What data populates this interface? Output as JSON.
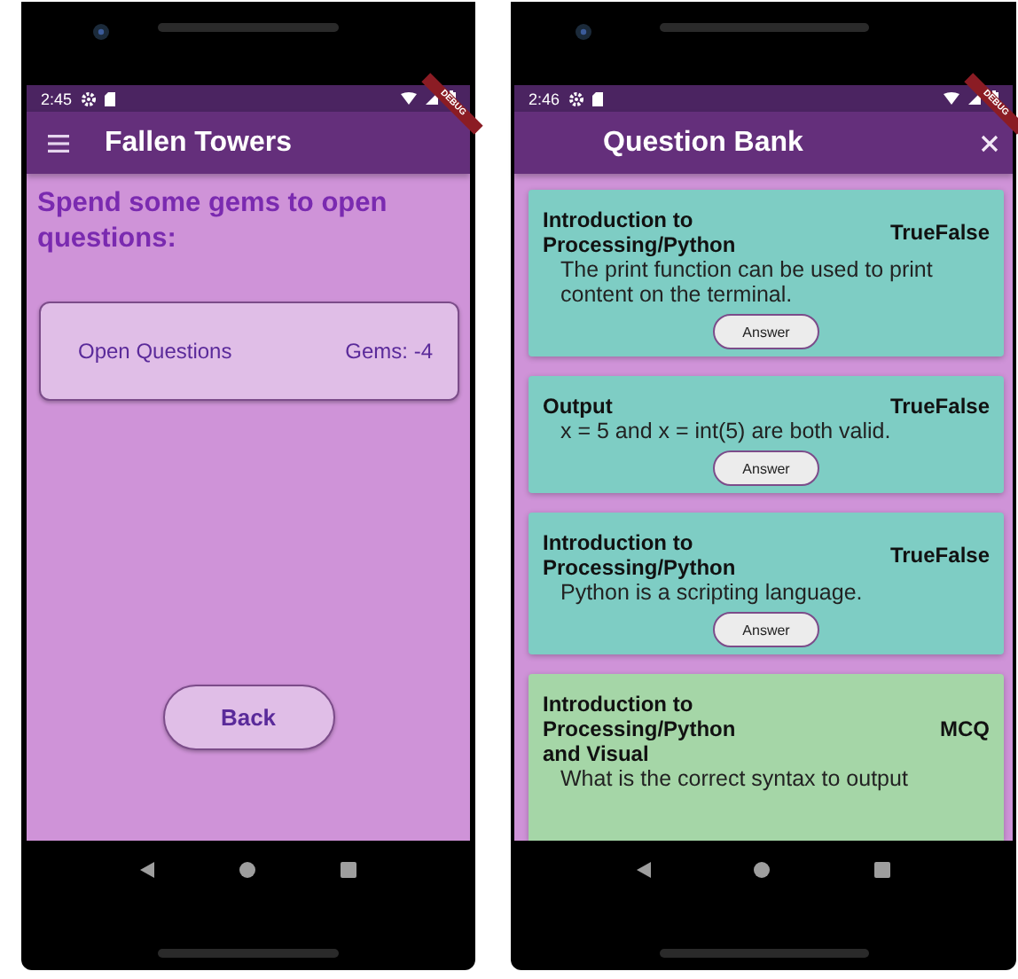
{
  "screens": [
    {
      "kind": "gems",
      "status_bar": {
        "time": "2:45"
      },
      "debug_banner": "DEBUG",
      "app_bar": {
        "title": "Fallen Towers"
      },
      "heading": "Spend some gems to open questions:",
      "card": {
        "label": "Open Questions",
        "gems": "Gems: -4"
      },
      "button": "Back"
    },
    {
      "kind": "question_bank",
      "status_bar": {
        "time": "2:46"
      },
      "debug_banner": "DEBUG",
      "app_bar": {
        "title": "Question Bank"
      },
      "questions": [
        {
          "topic": "Introduction to Processing/Python",
          "type": "TrueFalse",
          "text": "The print function can be used to print content on the terminal.",
          "button": "Answer",
          "color": "#7ecdc4"
        },
        {
          "topic": "Output",
          "type": "TrueFalse",
          "text": "x = 5 and x = int(5) are both valid.",
          "button": "Answer",
          "color": "#7ecdc4"
        },
        {
          "topic": "Introduction to Processing/Python",
          "type": "TrueFalse",
          "text": "Python is a scripting language.",
          "button": "Answer",
          "color": "#7ecdc4"
        },
        {
          "topic": "Introduction to Processing/Python and Visual",
          "type": "MCQ",
          "text": "What is the correct syntax to output",
          "color": "#a5d6a7"
        }
      ]
    }
  ]
}
